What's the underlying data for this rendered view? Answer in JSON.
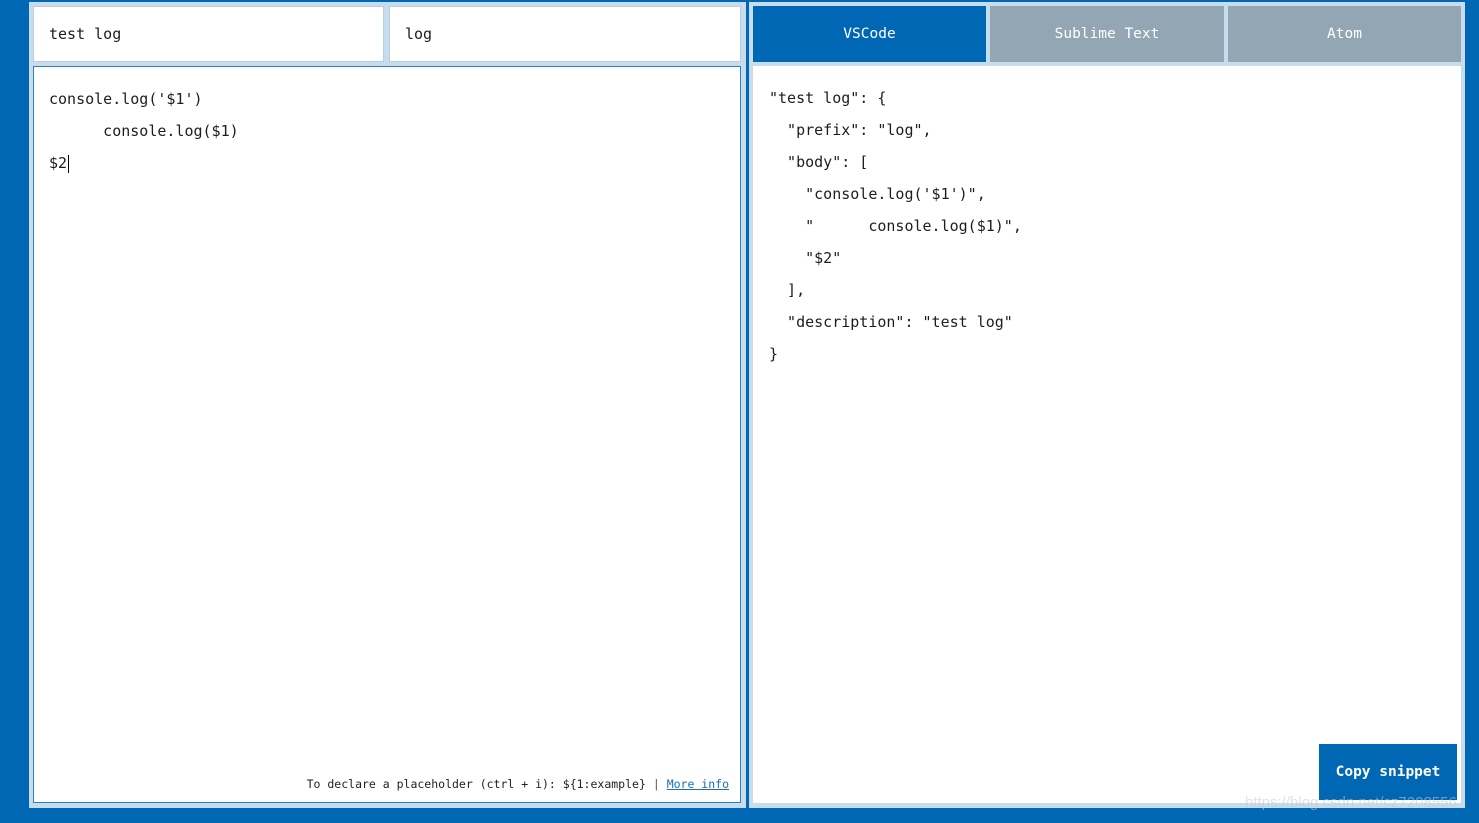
{
  "snippet": {
    "description": "test log",
    "prefix": "log"
  },
  "editor": {
    "lines": [
      "console.log('$1')",
      "      console.log($1)",
      "$2"
    ]
  },
  "hint": {
    "text": "To declare a placeholder (ctrl + i): ${1:example}",
    "separator": "|",
    "link_text": "More info"
  },
  "tabs": [
    {
      "label": "VSCode",
      "active": true
    },
    {
      "label": "Sublime Text",
      "active": false
    },
    {
      "label": "Atom",
      "active": false
    }
  ],
  "output": {
    "lines": [
      "\"test log\": {",
      "  \"prefix\": \"log\",",
      "  \"body\": [",
      "    \"console.log('$1')\",",
      "    \"      console.log($1)\",",
      "    \"$2\"",
      "  ],",
      "  \"description\": \"test log\"",
      "}"
    ]
  },
  "copy_button_label": "Copy snippet",
  "watermark": "https://blog.csdn.net/cz7208556",
  "colors": {
    "background": "#0067b5",
    "active_tab": "#0067b5",
    "inactive_tab": "#92a7b3",
    "link": "#1a6fb5"
  }
}
